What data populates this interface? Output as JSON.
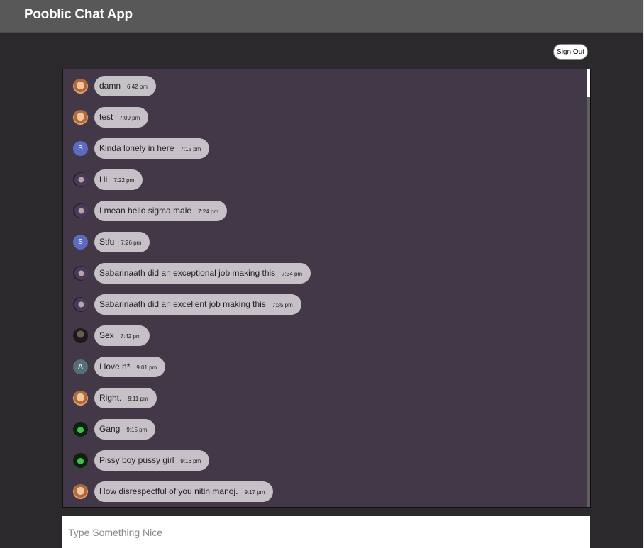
{
  "app": {
    "title": "Pooblic Chat App"
  },
  "header": {
    "sign_out_label": "Sign Out"
  },
  "messages": [
    {
      "avatar": "photo-orange",
      "letter": "",
      "text": "damn",
      "time": "6:42 pm"
    },
    {
      "avatar": "photo-orange",
      "letter": "",
      "text": "test",
      "time": "7:09 pm"
    },
    {
      "avatar": "letter-s",
      "letter": "S",
      "text": "Kinda lonely in here",
      "time": "7:15 pm"
    },
    {
      "avatar": "photo-dark",
      "letter": "",
      "text": "Hi",
      "time": "7:22 pm"
    },
    {
      "avatar": "photo-dark",
      "letter": "",
      "text": "I mean hello sigma male",
      "time": "7:24 pm"
    },
    {
      "avatar": "letter-s",
      "letter": "S",
      "text": "Stfu",
      "time": "7:26 pm"
    },
    {
      "avatar": "photo-dark",
      "letter": "",
      "text": "Sabarinaath did an exceptional job making this",
      "time": "7:34 pm"
    },
    {
      "avatar": "photo-dark",
      "letter": "",
      "text": "Sabarinaath did an excellent job making this",
      "time": "7:35 pm"
    },
    {
      "avatar": "photo-black",
      "letter": "",
      "text": "Sex",
      "time": "7:42 pm"
    },
    {
      "avatar": "letter-a",
      "letter": "A",
      "text": "I love n*",
      "time": "9:01 pm"
    },
    {
      "avatar": "photo-orange",
      "letter": "",
      "text": "Right.",
      "time": "9:11 pm"
    },
    {
      "avatar": "photo-green",
      "letter": "",
      "text": "Gang",
      "time": "9:15 pm"
    },
    {
      "avatar": "photo-green",
      "letter": "",
      "text": "Pissy boy pussy girl",
      "time": "9:16 pm"
    },
    {
      "avatar": "photo-orange",
      "letter": "",
      "text": "How disrespectful of you nitin manoj.",
      "time": "9:17 pm"
    }
  ],
  "composer": {
    "placeholder": "Type Something Nice",
    "value": ""
  },
  "colors": {
    "topbar": "#585858",
    "background": "#2b292b",
    "chat_panel": "#423848",
    "bubble": "#c6c1c6"
  }
}
